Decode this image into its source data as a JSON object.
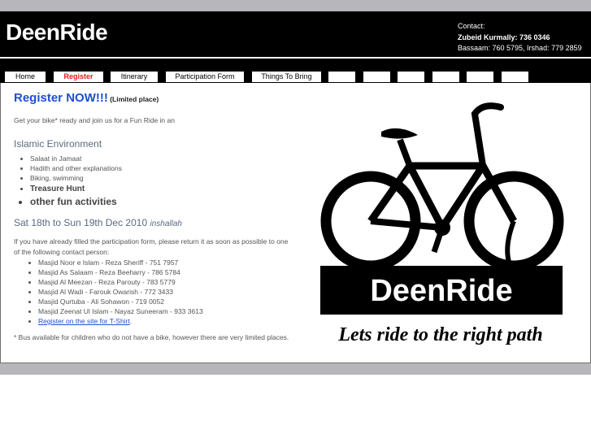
{
  "site": {
    "title": "DeenRide"
  },
  "contact": {
    "label": "Contact:",
    "primary": "Zubeid Kurmally: 736 0346",
    "secondary": "Bassaam: 760 5795, Irshad: 779 2859"
  },
  "nav": {
    "items": [
      {
        "label": "Home"
      },
      {
        "label": "Register",
        "active": true
      },
      {
        "label": "Itinerary"
      },
      {
        "label": "Participation Form"
      },
      {
        "label": "Things To Bring"
      },
      {
        "label": ""
      },
      {
        "label": ""
      },
      {
        "label": ""
      },
      {
        "label": ""
      },
      {
        "label": ""
      },
      {
        "label": ""
      }
    ]
  },
  "main": {
    "title": "Register NOW!!!",
    "title_sub": "(Limited place)",
    "intro": "Get your bike* ready and join us for a Fun Ride in an",
    "env_heading": "Islamic Environment",
    "activities": [
      "Salaat in Jamaat",
      "Hadith and other explanations",
      "Biking, swimming",
      "Treasure Hunt",
      "other fun activities"
    ],
    "date": "Sat 18th to Sun 19th Dec 2010",
    "date_suffix": "inshallah",
    "instructions": "If you have already filled the participation form, please return it as soon as possible to one of the following contact person:",
    "contacts": [
      "Masjid Noor e Islam - Reza Sheriff - 751 7957",
      "Masjid As Salaam - Reza Beeharry - 786 5784",
      "Masjid Al Meezan - Reza Parouty - 783 5779",
      "Masjid Al Wadi - Farouk Owarish - 772 3433",
      "Masjid Qurtuba - Ali Sohawon - 719 0052",
      "Masjid Zeenat Ul Islam - Nayaz Suneeram - 933 3613"
    ],
    "tshirt_link": "Register on the site for T-Shirt",
    "tshirt_link_suffix": ".",
    "note": "* Bus available for children who do not have a bike, however there are very limited places."
  },
  "logo_image": {
    "banner_text": "DeenRide",
    "tagline": "Lets ride to the right path"
  },
  "colors": {
    "accent_blue": "#1e4fd1",
    "active_red": "#e0201b",
    "header_black": "#000000",
    "heading_grey": "#5b6a80"
  }
}
